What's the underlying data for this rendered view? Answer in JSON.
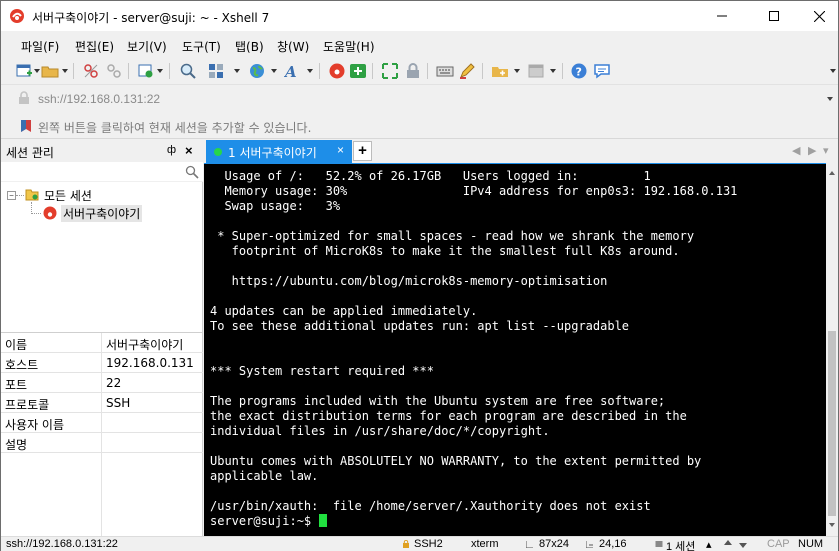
{
  "window": {
    "title": "서버구축이야기 - server@suji: ~ - Xshell 7",
    "accent": "#1e8ee8"
  },
  "menu": [
    "파일(F)",
    "편집(E)",
    "보기(V)",
    "도구(T)",
    "탭(B)",
    "창(W)",
    "도움말(H)"
  ],
  "address": {
    "value": "ssh://192.168.0.131:22"
  },
  "hint": {
    "text": "왼쪽 버튼을 클릭하여 현재 세션을 추가할 수 있습니다."
  },
  "session_panel": {
    "title": "세션 관리",
    "pin": "ф",
    "close": "×",
    "tree": {
      "folder": "모든 세션",
      "session": "서버구축이야기"
    },
    "properties": [
      {
        "key": "이름",
        "value": "서버구축이야기"
      },
      {
        "key": "호스트",
        "value": "192.168.0.131"
      },
      {
        "key": "포트",
        "value": "22"
      },
      {
        "key": "프로토콜",
        "value": "SSH"
      },
      {
        "key": "사용자 이름",
        "value": ""
      },
      {
        "key": "설명",
        "value": ""
      }
    ]
  },
  "tabs": {
    "active_label": "1 서버구축이야기",
    "close": "×",
    "add": "+"
  },
  "terminal": {
    "lines": [
      "  Usage of /:   52.2% of 26.17GB   Users logged in:         1",
      "  Memory usage: 30%                IPv4 address for enp0s3: 192.168.0.131",
      "  Swap usage:   3%",
      "",
      " * Super-optimized for small spaces - read how we shrank the memory",
      "   footprint of MicroK8s to make it the smallest full K8s around.",
      "",
      "   https://ubuntu.com/blog/microk8s-memory-optimisation",
      "",
      "4 updates can be applied immediately.",
      "To see these additional updates run: apt list --upgradable",
      "",
      "",
      "*** System restart required ***",
      "",
      "The programs included with the Ubuntu system are free software;",
      "the exact distribution terms for each program are described in the",
      "individual files in /usr/share/doc/*/copyright.",
      "",
      "Ubuntu comes with ABSOLUTELY NO WARRANTY, to the extent permitted by",
      "applicable law.",
      "",
      "/usr/bin/xauth:  file /home/server/.Xauthority does not exist"
    ],
    "prompt": "server@suji:~$ "
  },
  "status": {
    "address": "ssh://192.168.0.131:22",
    "protocol": "SSH2",
    "term": "xterm",
    "size": "87x24",
    "position": "24,16",
    "sessions": "1 세션",
    "cap": "CAP",
    "num": "NUM"
  }
}
